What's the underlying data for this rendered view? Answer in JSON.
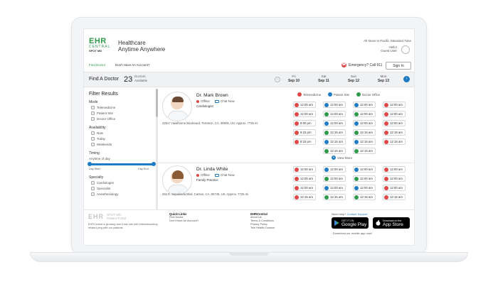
{
  "header": {
    "logo_main": "EHR",
    "logo_sub": "CENTRAL",
    "logo_spot": "SPOT MD",
    "tagline_1": "Healthcare",
    "tagline_2": "Anytime Anywhere",
    "timezone": "All times in Pacific Standard Time",
    "greeting": "Hello!",
    "user": "Guest User"
  },
  "nav": {
    "find_doctor": "Find Doctor",
    "no_account": "Don't Have An Account?",
    "emergency": "Emergency? Call 911",
    "sign_in": "Sign In"
  },
  "findbar": {
    "title": "Find A Doctor",
    "count": "23",
    "count_label_1": "Doctors",
    "count_label_2": "Available",
    "days": [
      {
        "dow": "Fri",
        "date": "Sep 10"
      },
      {
        "dow": "Sat",
        "date": "Sep 11"
      },
      {
        "dow": "Sun",
        "date": "Sep 12"
      },
      {
        "dow": "Mon",
        "date": "Sep 13"
      }
    ]
  },
  "filters": {
    "title": "Filter Results",
    "mode": {
      "label": "Mode",
      "options": [
        "Telemedicine",
        "Patient Site",
        "Doctor Office"
      ]
    },
    "availability": {
      "label": "Availability",
      "options": [
        "Now",
        "Today",
        "Weekends"
      ]
    },
    "timing": {
      "label": "Timing",
      "range": "Anytime of day",
      "start": "Day Start",
      "end": "Day End"
    },
    "specialty": {
      "label": "Specialty",
      "options": [
        "Cardiologist",
        "Specialist",
        "Anesthesiology"
      ]
    }
  },
  "legend": {
    "telemedicine": "Telemedicine",
    "patient_site": "Patient Site",
    "doctor_office": "Doctor Office"
  },
  "doctors": [
    {
      "name": "Dr. Mark Brown",
      "status": "Offline",
      "chat": "Chat Now",
      "specialty": "Cardiologist",
      "address": "22917 Hawthorne Boulevard, Torrance, CA. 90505, US.  Approx. 7725 mi",
      "slots": [
        [
          "12:00 am",
          "12:00 am",
          "12:00 am",
          "12:00 am"
        ],
        [
          "12:00 am",
          "12:00 am",
          "12:00 am",
          "12:00 am"
        ],
        [
          "8:00 pm",
          "12:00 am",
          "12:00 am",
          "12:00 am"
        ],
        [
          "8:15 pm",
          "12:15 am",
          "12:15 am",
          "12:15 am"
        ],
        [
          "8:15 pm",
          "12:15 am",
          "12:15 am",
          "12:15 am"
        ],
        [
          "",
          "12:15 am",
          "12:15 am",
          ""
        ]
      ]
    },
    {
      "name": "Dr. Linda White",
      "status": "Offline",
      "chat": "Chat Now",
      "specialty": "Family Practice",
      "address": "262 E. Sepulveda Blvd. Carson, CA. 90745, US.  Approx. 7725 mi",
      "slots": [
        [
          "12:00 am",
          "12:00 am",
          "12:00 am",
          "12:00 am"
        ],
        [
          "12:00 am",
          "12:00 am",
          "12:00 am",
          "12:00 am"
        ],
        [
          "12:00 am",
          "12:00 am",
          "12:00 am",
          "12:00 am"
        ],
        [
          "12:15 am",
          "12:15 am",
          "12:15 am",
          "12:15 am"
        ]
      ]
    }
  ],
  "view_more": "View More",
  "footer": {
    "logo": "EHR",
    "logo_spot": "SPOT MD",
    "logo_sub": "Patient Portal",
    "description": "EHRCentral is growing and it has lots with internetworking related ping with our patients",
    "quick_links": {
      "title": "Quick Links",
      "items": [
        "Find Doctor",
        "Don't Have An Account?"
      ]
    },
    "ehrcentral": {
      "title": "EHRCentral",
      "items": [
        "About Us",
        "Terms & Conditions",
        "Privacy Policy",
        "Tele Health Consent"
      ]
    },
    "help": "Need help?",
    "help_link": "Contact Support",
    "google_small": "GET IT ON",
    "google_big": "Google Play",
    "apple_small": "Download on the",
    "apple_big": "App Store",
    "download": "Download our mobile app now!"
  },
  "colors": {
    "green": "#2e9a4a",
    "blue": "#1f7bc4",
    "red": "#e04848"
  }
}
